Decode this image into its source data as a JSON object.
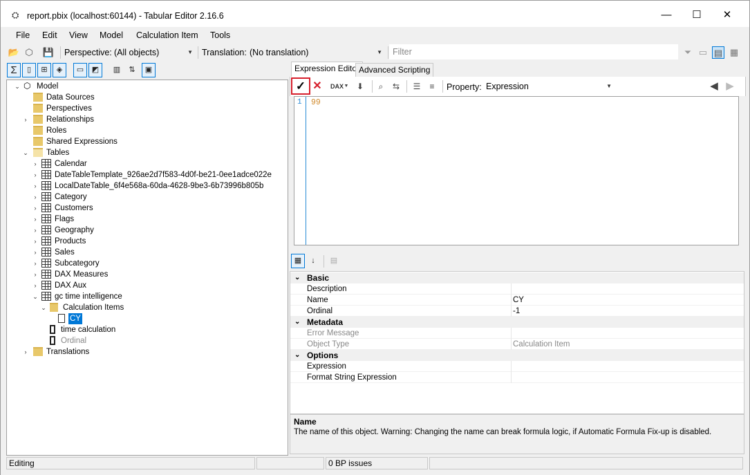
{
  "window": {
    "title": "report.pbix (localhost:60144) - Tabular Editor 2.16.6",
    "minimize": "—",
    "maximize": "☐",
    "close": "✕"
  },
  "menu": [
    {
      "label": "File"
    },
    {
      "label": "Edit"
    },
    {
      "label": "View"
    },
    {
      "label": "Model"
    },
    {
      "label": "Calculation Item"
    },
    {
      "label": "Tools"
    }
  ],
  "toolbar": {
    "perspective_label": "Perspective:",
    "perspective_value": "(All objects)",
    "translation_label": "Translation:",
    "translation_value": "(No translation)",
    "filter_placeholder": "Filter"
  },
  "tree": {
    "model": "Model",
    "data_sources": "Data Sources",
    "perspectives": "Perspectives",
    "relationships": "Relationships",
    "roles": "Roles",
    "shared_expressions": "Shared Expressions",
    "tables": "Tables",
    "table_items": [
      "Calendar",
      "DateTableTemplate_926ae2d7f583-4d0f-be21-0ee1adce022e",
      "LocalDateTable_6f4e568a-60da-4628-9be3-6b73996b805b",
      "Category",
      "Customers",
      "Flags",
      "Geography",
      "Products",
      "Sales",
      "Subcategory",
      "DAX Measures",
      "DAX Aux"
    ],
    "calc_group": "gc time intelligence",
    "calc_items_folder": "Calculation Items",
    "calc_item_selected": "CY",
    "time_calculation": "time calculation",
    "ordinal": "Ordinal",
    "translations": "Translations"
  },
  "editor": {
    "tab_expression": "Expression Editor",
    "tab_scripting": "Advanced Scripting",
    "property_label": "Property:",
    "property_value": "Expression",
    "line_number": "1",
    "code": "99"
  },
  "properties": {
    "cat_basic": "Basic",
    "description_label": "Description",
    "description_value": "",
    "name_label": "Name",
    "name_value": "CY",
    "ordinal_label": "Ordinal",
    "ordinal_value": "-1",
    "cat_metadata": "Metadata",
    "error_label": "Error Message",
    "error_value": "",
    "objtype_label": "Object Type",
    "objtype_value": "Calculation Item",
    "cat_options": "Options",
    "expression_label": "Expression",
    "expression_value": "",
    "format_label": "Format String Expression",
    "format_value": ""
  },
  "description_panel": {
    "title": "Name",
    "text": "The name of this object. Warning: Changing the name can break formula logic, if Automatic Formula Fix-up is disabled."
  },
  "status": {
    "mode": "Editing",
    "bp_issues": "0 BP issues"
  }
}
